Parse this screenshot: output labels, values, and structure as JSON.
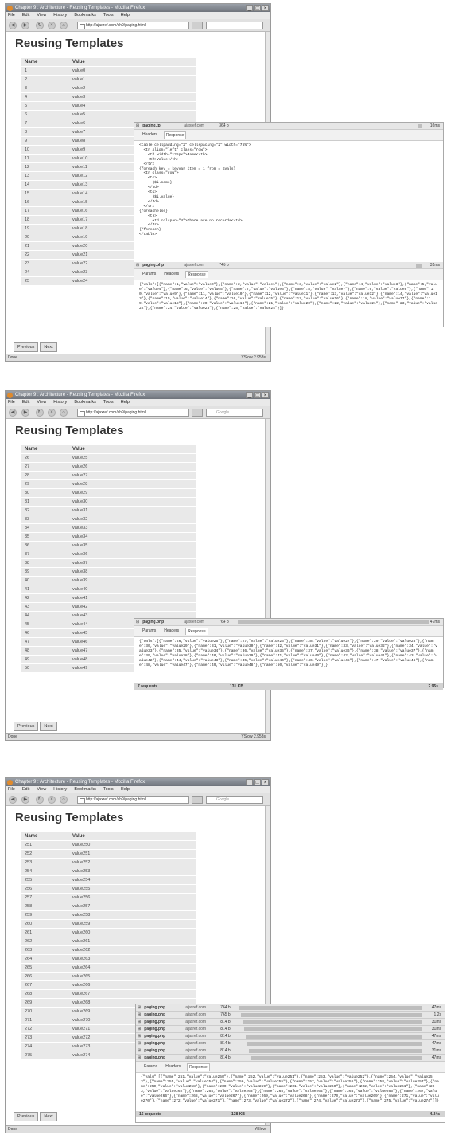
{
  "browser": {
    "window_title": "Chapter 9 : Architecture - Reusing Templates - Mozilla Firefox",
    "menu": [
      "File",
      "Edit",
      "View",
      "History",
      "Bookmarks",
      "Tools",
      "Help"
    ],
    "url": "http://ajaxref.com/ch9/paging.html",
    "search_placeholder": "Google",
    "status_done": "Done",
    "yslow": "YSlow"
  },
  "page": {
    "heading": "Reusing Templates",
    "col_name": "Name",
    "col_value": "Value",
    "prev_label": "Previous",
    "next_label": "Next"
  },
  "screens": [
    {
      "rows": [
        [
          "1",
          "value0"
        ],
        [
          "2",
          "value1"
        ],
        [
          "3",
          "value2"
        ],
        [
          "4",
          "value3"
        ],
        [
          "5",
          "value4"
        ],
        [
          "6",
          "value5"
        ],
        [
          "7",
          "value6"
        ],
        [
          "8",
          "value7"
        ],
        [
          "9",
          "value8"
        ],
        [
          "10",
          "value9"
        ],
        [
          "11",
          "value10"
        ],
        [
          "12",
          "value11"
        ],
        [
          "13",
          "value12"
        ],
        [
          "14",
          "value13"
        ],
        [
          "15",
          "value14"
        ],
        [
          "16",
          "value15"
        ],
        [
          "17",
          "value16"
        ],
        [
          "18",
          "value17"
        ],
        [
          "19",
          "value18"
        ],
        [
          "20",
          "value19"
        ],
        [
          "21",
          "value20"
        ],
        [
          "22",
          "value21"
        ],
        [
          "23",
          "value22"
        ],
        [
          "24",
          "value23"
        ],
        [
          "25",
          "value24"
        ]
      ],
      "status_time": "2.953s"
    },
    {
      "rows": [
        [
          "26",
          "value25"
        ],
        [
          "27",
          "value26"
        ],
        [
          "28",
          "value27"
        ],
        [
          "29",
          "value28"
        ],
        [
          "30",
          "value29"
        ],
        [
          "31",
          "value30"
        ],
        [
          "32",
          "value31"
        ],
        [
          "33",
          "value32"
        ],
        [
          "34",
          "value33"
        ],
        [
          "35",
          "value34"
        ],
        [
          "36",
          "value35"
        ],
        [
          "37",
          "value36"
        ],
        [
          "38",
          "value37"
        ],
        [
          "39",
          "value38"
        ],
        [
          "40",
          "value39"
        ],
        [
          "41",
          "value40"
        ],
        [
          "42",
          "value41"
        ],
        [
          "43",
          "value42"
        ],
        [
          "44",
          "value43"
        ],
        [
          "45",
          "value44"
        ],
        [
          "46",
          "value45"
        ],
        [
          "47",
          "value46"
        ],
        [
          "48",
          "value47"
        ],
        [
          "49",
          "value48"
        ],
        [
          "50",
          "value49"
        ]
      ],
      "status_time": "2.953s"
    },
    {
      "rows": [
        [
          "251",
          "value250"
        ],
        [
          "252",
          "value251"
        ],
        [
          "253",
          "value252"
        ],
        [
          "254",
          "value253"
        ],
        [
          "255",
          "value254"
        ],
        [
          "256",
          "value255"
        ],
        [
          "257",
          "value256"
        ],
        [
          "258",
          "value257"
        ],
        [
          "259",
          "value258"
        ],
        [
          "260",
          "value259"
        ],
        [
          "261",
          "value260"
        ],
        [
          "262",
          "value261"
        ],
        [
          "263",
          "value262"
        ],
        [
          "264",
          "value263"
        ],
        [
          "265",
          "value264"
        ],
        [
          "266",
          "value265"
        ],
        [
          "267",
          "value266"
        ],
        [
          "268",
          "value267"
        ],
        [
          "269",
          "value268"
        ],
        [
          "270",
          "value269"
        ],
        [
          "271",
          "value270"
        ],
        [
          "272",
          "value271"
        ],
        [
          "273",
          "value272"
        ],
        [
          "274",
          "value273"
        ],
        [
          "275",
          "value274"
        ]
      ],
      "status_time": ""
    }
  ],
  "firebug": {
    "panel1": {
      "tpl_request": {
        "name": "paging.tpl",
        "host": "ajaxref.com",
        "size": "364 b",
        "time": "16ms"
      },
      "tabs_top": [
        "Headers",
        "Response"
      ],
      "template_code": "<table cellpadding=\"2\" cellspacing=\"2\" width=\"75%\">\n  <tr align=\"left\" class=\"row\">\n    <th width=\"125px\">Name</th>\n    <th>Value</th>\n  </tr>\n{foreach key = keyvar item = i from = $vals}\n  <tr class=\"row\">\n    <td>\n      {$i.name}\n    </td>\n    <td>\n      {$i.value}\n    </td>\n  </tr>\n{foreachelse}\n    <tr>\n      <td colspan=\"4\">There are no records</td>\n    </tr>\n{/foreach}\n</table>",
      "php_request": {
        "name": "paging.php",
        "host": "ajaxref.com",
        "size": "745 b",
        "time": "31ms"
      },
      "tabs_bottom": [
        "Params",
        "Headers",
        "Response"
      ],
      "json": "{\"vals\":[{\"name\":1,\"value\":\"value0\"},{\"name\":2,\"value\":\"value1\"},{\"name\":3,\"value\":\"value2\"},{\"name\":4,\"value\":\"value3\"},{\"name\":5,\"value\":\"value4\"},{\"name\":6,\"value\":\"value5\"},{\"name\":7,\"value\":\"value6\"},{\"name\":8,\"value\":\"value7\"},{\"name\":9,\"value\":\"value8\"},{\"name\":10,\"value\":\"value9\"},{\"name\":11,\"value\":\"value10\"},{\"name\":12,\"value\":\"value11\"},{\"name\":13,\"value\":\"value12\"},{\"name\":14,\"value\":\"value13\"},{\"name\":15,\"value\":\"value14\"},{\"name\":16,\"value\":\"value15\"},{\"name\":17,\"value\":\"value16\"},{\"name\":18,\"value\":\"value17\"},{\"name\":19,\"value\":\"value18\"},{\"name\":20,\"value\":\"value19\"},{\"name\":21,\"value\":\"value20\"},{\"name\":22,\"value\":\"value21\"},{\"name\":23,\"value\":\"value22\"},{\"name\":24,\"value\":\"value23\"},{\"name\":25,\"value\":\"value24\"}]}"
    },
    "panel2": {
      "php_request": {
        "name": "paging.php",
        "host": "ajaxref.com",
        "size": "764 b",
        "time": "47ms"
      },
      "tabs": [
        "Params",
        "Headers",
        "Response"
      ],
      "json": "{\"vals\":[{\"name\":26,\"value\":\"value25\"},{\"name\":27,\"value\":\"value26\"},{\"name\":28,\"value\":\"value27\"},{\"name\":29,\"value\":\"value28\"},{\"name\":30,\"value\":\"value29\"},{\"name\":31,\"value\":\"value30\"},{\"name\":32,\"value\":\"value31\"},{\"name\":33,\"value\":\"value32\"},{\"name\":34,\"value\":\"value33\"},{\"name\":35,\"value\":\"value34\"},{\"name\":36,\"value\":\"value35\"},{\"name\":37,\"value\":\"value36\"},{\"name\":38,\"value\":\"value37\"},{\"name\":39,\"value\":\"value38\"},{\"name\":40,\"value\":\"value39\"},{\"name\":41,\"value\":\"value40\"},{\"name\":42,\"value\":\"value41\"},{\"name\":43,\"value\":\"value42\"},{\"name\":44,\"value\":\"value43\"},{\"name\":45,\"value\":\"value44\"},{\"name\":46,\"value\":\"value45\"},{\"name\":47,\"value\":\"value46\"},{\"name\":48,\"value\":\"value47\"},{\"name\":49,\"value\":\"value48\"},{\"name\":50,\"value\":\"value49\"}]}",
      "summary": {
        "requests": "7 requests",
        "size": "131 KB",
        "time": "2.95s"
      }
    },
    "panel3": {
      "requests": [
        {
          "name": "paging.php",
          "host": "ajaxref.com",
          "size": "764 b",
          "time": "47ms"
        },
        {
          "name": "paging.php",
          "host": "ajaxref.com",
          "size": "765 b",
          "time": "1.2s"
        },
        {
          "name": "paging.php",
          "host": "ajaxref.com",
          "size": "814 b",
          "time": "31ms"
        },
        {
          "name": "paging.php",
          "host": "ajaxref.com",
          "size": "814 b",
          "time": "31ms"
        },
        {
          "name": "paging.php",
          "host": "ajaxref.com",
          "size": "814 b",
          "time": "47ms"
        },
        {
          "name": "paging.php",
          "host": "ajaxref.com",
          "size": "814 b",
          "time": "47ms"
        },
        {
          "name": "paging.php",
          "host": "ajaxref.com",
          "size": "814 b",
          "time": "31ms"
        },
        {
          "name": "paging.php",
          "host": "ajaxref.com",
          "size": "814 b",
          "time": "47ms"
        }
      ],
      "tabs": [
        "Params",
        "Headers",
        "Response"
      ],
      "json": "{\"vals\":[{\"name\":251,\"value\":\"value250\"},{\"name\":252,\"value\":\"value251\"},{\"name\":253,\"value\":\"value252\"},{\"name\":254,\"value\":\"value253\"},{\"name\":255,\"value\":\"value254\"},{\"name\":256,\"value\":\"value255\"},{\"name\":257,\"value\":\"value256\"},{\"name\":258,\"value\":\"value257\"},{\"name\":259,\"value\":\"value258\"},{\"name\":260,\"value\":\"value259\"},{\"name\":261,\"value\":\"value260\"},{\"name\":262,\"value\":\"value261\"},{\"name\":263,\"value\":\"value262\"},{\"name\":264,\"value\":\"value263\"},{\"name\":265,\"value\":\"value264\"},{\"name\":266,\"value\":\"value265\"},{\"name\":267,\"value\":\"value266\"},{\"name\":268,\"value\":\"value267\"},{\"name\":269,\"value\":\"value268\"},{\"name\":270,\"value\":\"value269\"},{\"name\":271,\"value\":\"value270\"},{\"name\":272,\"value\":\"value271\"},{\"name\":273,\"value\":\"value272\"},{\"name\":274,\"value\":\"value273\"},{\"name\":275,\"value\":\"value274\"}]}",
      "summary": {
        "requests": "16 requests",
        "size": "138 KB",
        "time": "4.34s"
      }
    }
  }
}
